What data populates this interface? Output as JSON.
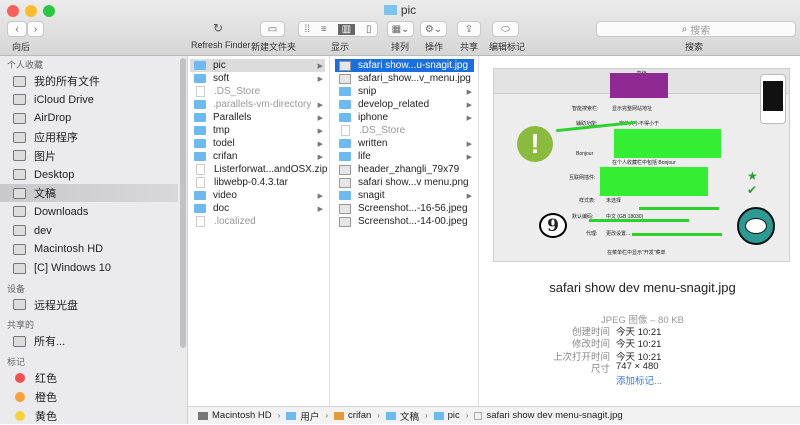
{
  "window": {
    "title": "pic"
  },
  "toolbar": {
    "back_label": "向后",
    "refresh_label": "Refresh Finder",
    "new_folder_label": "新建文件夹",
    "view_label": "显示",
    "arrange_label": "排列",
    "action_label": "操作",
    "share_label": "共享",
    "tags_label": "编辑标记",
    "search_placeholder": "搜索",
    "search_label": "搜索"
  },
  "sidebar": {
    "favorites_header": "个人收藏",
    "favorites": [
      {
        "label": "我的所有文件"
      },
      {
        "label": "iCloud Drive"
      },
      {
        "label": "AirDrop"
      },
      {
        "label": "应用程序"
      },
      {
        "label": "图片"
      },
      {
        "label": "Desktop"
      },
      {
        "label": "文稿",
        "selected": true
      },
      {
        "label": "Downloads"
      },
      {
        "label": "dev"
      },
      {
        "label": "Macintosh HD"
      },
      {
        "label": "[C] Windows 10"
      }
    ],
    "devices_header": "设备",
    "devices": [
      {
        "label": "远程光盘"
      }
    ],
    "shared_header": "共享的",
    "shared": [
      {
        "label": "所有..."
      }
    ],
    "tags_header": "标记",
    "tags": [
      {
        "label": "红色",
        "color": "#f4504f"
      },
      {
        "label": "橙色",
        "color": "#f7a035"
      },
      {
        "label": "黄色",
        "color": "#f6d13a"
      }
    ]
  },
  "column1": [
    {
      "name": "pic",
      "type": "folder",
      "arrow": true,
      "selected_parent": true
    },
    {
      "name": "soft",
      "type": "folder",
      "arrow": true
    },
    {
      "name": ".DS_Store",
      "type": "file",
      "dim": true
    },
    {
      "name": ".parallels-vm-directory",
      "type": "folder",
      "arrow": true,
      "dim": true
    },
    {
      "name": "Parallels",
      "type": "folder",
      "arrow": true
    },
    {
      "name": "tmp",
      "type": "folder",
      "arrow": true
    },
    {
      "name": "todel",
      "type": "folder",
      "arrow": true
    },
    {
      "name": "crifan",
      "type": "folder",
      "arrow": true
    },
    {
      "name": "Listerforwat...andOSX.zip",
      "type": "file"
    },
    {
      "name": "libwebp-0.4.3.tar",
      "type": "file"
    },
    {
      "name": "video",
      "type": "folder",
      "arrow": true
    },
    {
      "name": "doc",
      "type": "folder",
      "arrow": true
    },
    {
      "name": ".localized",
      "type": "file",
      "dim": true
    }
  ],
  "column2": [
    {
      "name": "safari show...u-snagit.jpg",
      "type": "image",
      "selected": true
    },
    {
      "name": "safari_show...v_menu.jpg",
      "type": "image"
    },
    {
      "name": "snip",
      "type": "folder",
      "arrow": true
    },
    {
      "name": "develop_related",
      "type": "folder",
      "arrow": true
    },
    {
      "name": "iphone",
      "type": "folder",
      "arrow": true
    },
    {
      "name": ".DS_Store",
      "type": "file",
      "dim": true
    },
    {
      "name": "written",
      "type": "folder",
      "arrow": true
    },
    {
      "name": "life",
      "type": "folder",
      "arrow": true
    },
    {
      "name": "header_zhangli_79x79",
      "type": "image"
    },
    {
      "name": "safari show...v menu.png",
      "type": "image"
    },
    {
      "name": "snagit",
      "type": "folder",
      "arrow": true
    },
    {
      "name": "Screenshot...-16-56.jpeg",
      "type": "image"
    },
    {
      "name": "Screenshot...-14-00.jpeg",
      "type": "image"
    }
  ],
  "preview": {
    "filename": "safari show dev menu-snagit.jpg",
    "kind": "JPEG 图像 – 80 KB",
    "meta": [
      {
        "key": "创建时间",
        "value": "今天 10:21"
      },
      {
        "key": "修改时间",
        "value": "今天 10:21"
      },
      {
        "key": "上次打开时间",
        "value": "今天 10:21"
      },
      {
        "key": "尺寸",
        "value": "747 × 480"
      }
    ],
    "add_tags": "添加标记...",
    "thumb": {
      "title": "高级",
      "bonjour": "Bonjour",
      "bonjour_opt": "在个人收藏栏中包括 Bonjour",
      "smart": "智能搜索栏:",
      "smart_opt": "显示完整网站地址",
      "access": "辅助功能:",
      "access_opt": "字体大小不得小于",
      "plugins": "互联网插件:",
      "style": "样式表:",
      "style_val": "未选择",
      "encoding": "默认编码:",
      "encoding_val": "中文 (GB 18030)",
      "proxy": "代理:",
      "proxy_val": "更改设置...",
      "dev": "在菜单栏中显示\"开发\"菜单",
      "nine": "9"
    }
  },
  "pathbar": [
    {
      "label": "Macintosh HD"
    },
    {
      "label": "用户"
    },
    {
      "label": "crifan"
    },
    {
      "label": "文稿"
    },
    {
      "label": "pic"
    },
    {
      "label": "safari show dev menu-snagit.jpg"
    }
  ]
}
